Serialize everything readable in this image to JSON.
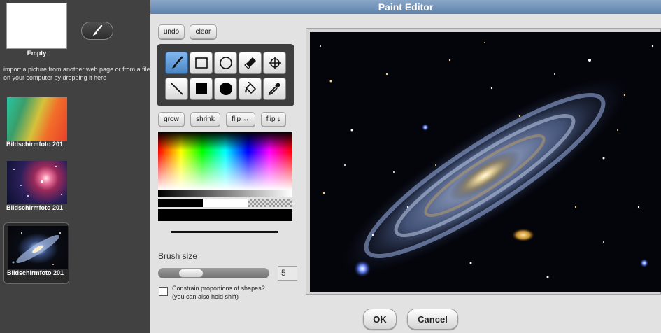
{
  "left_panel": {
    "empty_label": "Empty",
    "import_text": "import a picture from another web page or from a file on your computer by dropping it here",
    "costumes": [
      {
        "name": "Bildschirmfoto 201"
      },
      {
        "name": "Bildschirmfoto 201"
      },
      {
        "name": "Bildschirmfoto 201"
      }
    ]
  },
  "dialog": {
    "title": "Paint Editor",
    "undo": "undo",
    "clear": "clear",
    "grow": "grow",
    "shrink": "shrink",
    "flip_h": "flip ↔",
    "flip_v": "flip ↕",
    "brush_size_label": "Brush size",
    "brush_size_value": "5",
    "constrain_line1": "Constrain proportions of shapes?",
    "constrain_line2": "(you can also hold shift)",
    "ok": "OK",
    "cancel": "Cancel"
  },
  "tools": [
    {
      "name": "brush-tool-icon"
    },
    {
      "name": "rectangle-tool-icon"
    },
    {
      "name": "ellipse-tool-icon"
    },
    {
      "name": "eraser-tool-icon"
    },
    {
      "name": "rotation-center-tool-icon"
    },
    {
      "name": "line-tool-icon"
    },
    {
      "name": "filled-rectangle-tool-icon"
    },
    {
      "name": "filled-ellipse-tool-icon"
    },
    {
      "name": "paint-bucket-tool-icon"
    },
    {
      "name": "eyedropper-tool-icon"
    }
  ],
  "colors": {
    "title_bar_top": "#8aa7c8",
    "title_bar_bottom": "#5f82ab",
    "active_tool": "#4a86c6",
    "current_color": "#000000"
  }
}
